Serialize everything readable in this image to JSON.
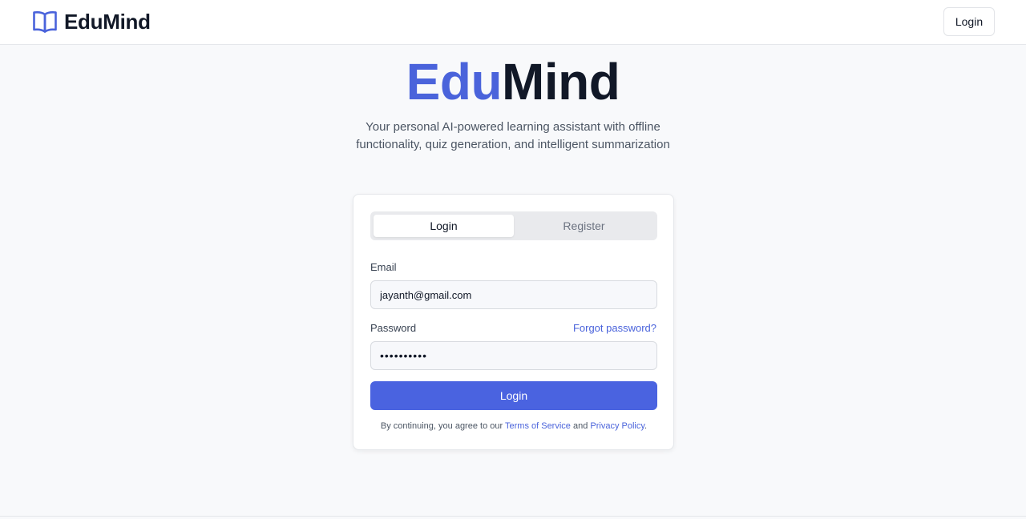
{
  "brand": {
    "name": "EduMind",
    "icon": "book-open-icon",
    "accent": "#4a63db"
  },
  "header": {
    "login_label": "Login"
  },
  "hero": {
    "title_part1": "Edu",
    "title_part2": "Mind",
    "subtitle": "Your personal AI-powered learning assistant with offline functionality, quiz generation, and intelligent summarization"
  },
  "auth": {
    "tabs": [
      {
        "label": "Login",
        "active": true
      },
      {
        "label": "Register",
        "active": false
      }
    ],
    "email_label": "Email",
    "email_value": "jayanth@gmail.com",
    "password_label": "Password",
    "forgot_label": "Forgot password?",
    "password_value": "jayanth123",
    "submit_label": "Login",
    "terms_prefix": "By continuing, you agree to our ",
    "terms_link": "Terms of Service",
    "terms_and": " and ",
    "privacy_link": "Privacy Policy",
    "terms_suffix": "."
  }
}
